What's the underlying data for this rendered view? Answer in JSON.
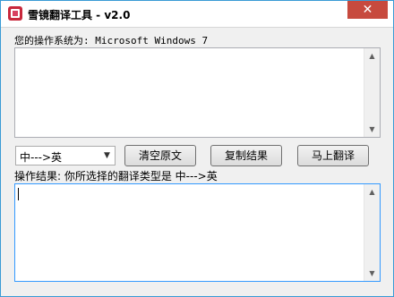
{
  "window": {
    "title": "雪镜翻译工具 - v2.0",
    "close_glyph": "✕"
  },
  "os_label": "您的操作系统为: Microsoft Windows 7",
  "source_text": "",
  "direction": {
    "selected": "中--->英",
    "dropdown_glyph": "▼"
  },
  "buttons": {
    "clear": "清空原文",
    "copy": "复制结果",
    "translate": "马上翻译"
  },
  "result_label": "操作结果: 你所选择的翻译类型是  中--->英",
  "result_text": "",
  "scroll_glyphs": {
    "up": "▲",
    "down": "▼"
  }
}
